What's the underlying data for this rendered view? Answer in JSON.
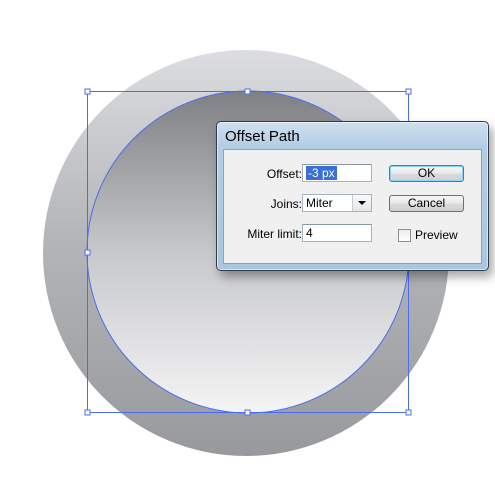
{
  "dialog": {
    "title": "Offset Path",
    "offset_label": "Offset:",
    "offset_value": "-3 px",
    "joins_label": "Joins:",
    "joins_value": "Miter",
    "miter_limit_label": "Miter limit:",
    "miter_limit_value": "4",
    "ok_label": "OK",
    "cancel_label": "Cancel",
    "preview_label": "Preview",
    "preview_checked": false
  },
  "colors": {
    "selection_blue": "#4a6cf0",
    "dialog_frame": "#a9c6e0"
  }
}
